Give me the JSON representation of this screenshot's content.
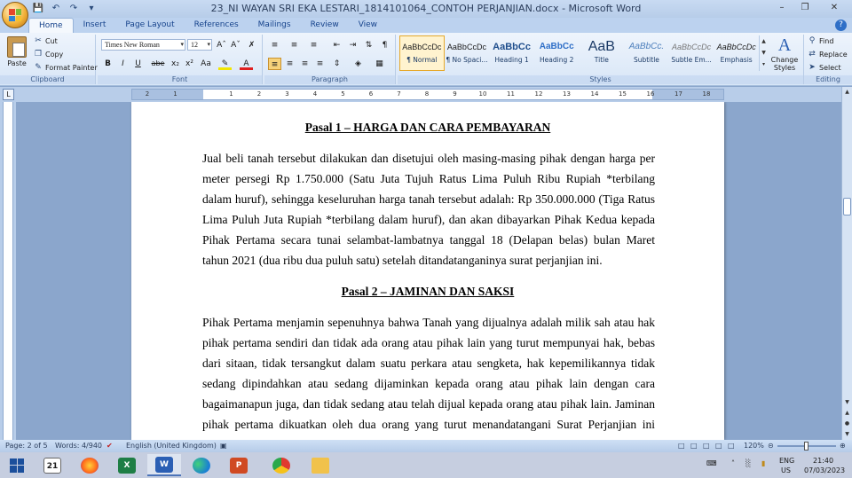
{
  "window": {
    "title": "23_NI WAYAN SRI EKA LESTARI_1814101064_CONTOH PERJANJIAN.docx - Microsoft Word",
    "minimize": "–",
    "restore": "❐",
    "close": "✕"
  },
  "tabs": [
    "Home",
    "Insert",
    "Page Layout",
    "References",
    "Mailings",
    "Review",
    "View"
  ],
  "help": "?",
  "ribbon": {
    "clipboard": {
      "paste": "Paste",
      "cut": "Cut",
      "copy": "Copy",
      "format_painter": "Format Painter",
      "label": "Clipboard"
    },
    "font": {
      "name": "Times New Roman",
      "size": "12",
      "label": "Font",
      "buttons": [
        "B",
        "I",
        "U",
        "abe",
        "x₂",
        "x²",
        "Aa"
      ]
    },
    "paragraph": {
      "label": "Paragraph"
    },
    "styles": {
      "label": "Styles",
      "items": [
        {
          "sample": "AaBbCcDc",
          "name": "¶ Normal"
        },
        {
          "sample": "AaBbCcDc",
          "name": "¶ No Spaci..."
        },
        {
          "sample": "AaBbCc",
          "name": "Heading 1"
        },
        {
          "sample": "AaBbCc",
          "name": "Heading 2"
        },
        {
          "sample": "AaB",
          "name": "Title"
        },
        {
          "sample": "AaBbCc.",
          "name": "Subtitle"
        },
        {
          "sample": "AaBbCcDc",
          "name": "Subtle Em..."
        },
        {
          "sample": "AaBbCcDc",
          "name": "Emphasis"
        }
      ],
      "change_styles": "Change Styles"
    },
    "editing": {
      "label": "Editing",
      "find": "Find",
      "replace": "Replace",
      "select": "Select"
    }
  },
  "ruler_numbers": [
    "2",
    "1",
    "1",
    "2",
    "3",
    "4",
    "5",
    "6",
    "7",
    "8",
    "9",
    "10",
    "11",
    "12",
    "13",
    "14",
    "15",
    "16",
    "17",
    "18"
  ],
  "document": {
    "heading1": "Pasal 1 – HARGA DAN CARA PEMBAYARAN",
    "para1": [
      "Jual beli tanah tersebut dilakukan dan disetujui oleh masing-masing pihak dengan harga per",
      "meter persegi Rp 1.750.000 (Satu Juta Tujuh Ratus Lima Puluh Ribu Rupiah *terbilang",
      "dalam huruf), sehingga keseluruhan harga tanah tersebut adalah: Rp 350.000.000 (Tiga Ratus",
      "Lima Puluh Juta Rupiah *terbilang dalam huruf), dan akan dibayarkan Pihak Kedua kepada",
      "Pihak Pertama secara tunai selambat-lambatnya tanggal 18 (Delapan belas) bulan Maret",
      "tahun 2021 (dua ribu dua puluh satu) setelah ditandatanganinya surat perjanjian ini."
    ],
    "heading2": "Pasal 2 – JAMINAN DAN SAKSI",
    "para2": [
      "Pihak Pertama menjamin sepenuhnya bahwa Tanah yang dijualnya adalah milik sah atau hak",
      "pihak pertama sendiri dan tidak ada orang atau pihak lain yang turut mempunyai hak, bebas",
      "dari sitaan, tidak tersangkut dalam suatu perkara atau sengketa, hak kepemilikannya tidak",
      "sedang dipindahkan atau sedang dijaminkan kepada orang atau pihak lain dengan cara",
      "bagaimanapun juga, dan tidak sedang atau telah dijual kepada orang atau pihak lain. Jaminan",
      "pihak pertama dikuatkan oleh dua orang yang turut menandatangani Surat Perjanjian ini"
    ]
  },
  "status": {
    "page": "Page: 2 of 5",
    "words": "Words: 4/940",
    "language": "English (United Kingdom)",
    "zoom": "120%"
  },
  "taskbar": {
    "calendar_day": "21",
    "lang": "ENG",
    "region": "US",
    "time": "21:40",
    "date": "07/03/2023"
  }
}
